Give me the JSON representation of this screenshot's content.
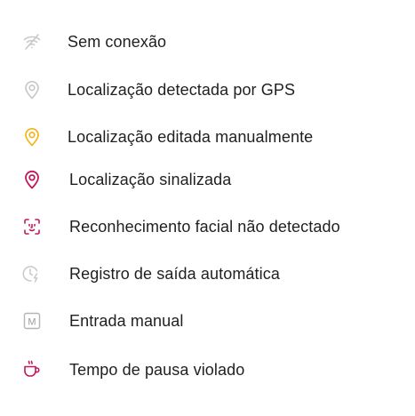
{
  "legend": {
    "items": [
      {
        "label": "Sem conexão",
        "icon": "no-wifi-icon",
        "color": "#c9c9c9"
      },
      {
        "label": "Localização detectada por GPS",
        "icon": "location-pin-icon",
        "color": "#c9c9c9"
      },
      {
        "label": "Localização editada manualmente",
        "icon": "location-pin-edited-icon",
        "color": "#f2b61b"
      },
      {
        "label": "Localização sinalizada",
        "icon": "location-pin-flagged-icon",
        "color": "#c2185b"
      },
      {
        "label": "Reconhecimento facial não detectado",
        "icon": "face-scan-icon",
        "color": "#c2185b"
      },
      {
        "label": "Registro de saída automática",
        "icon": "auto-clock-out-icon",
        "color": "#c9c9c9"
      },
      {
        "label": "Entrada manual",
        "icon": "manual-entry-icon",
        "color": "#b5b5b5",
        "badge": "M"
      },
      {
        "label": "Tempo de pausa violado",
        "icon": "coffee-cup-icon",
        "color": "#c2185b"
      }
    ]
  }
}
